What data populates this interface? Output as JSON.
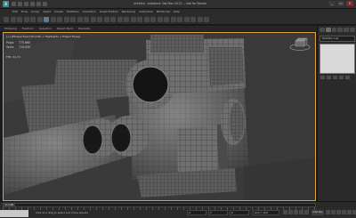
{
  "app": {
    "logo": "3",
    "title": "Untitled - Autodesk 3ds Max 2013 — Not for Resale"
  },
  "window_controls": [
    "_",
    "▭",
    "✕"
  ],
  "menus": [
    "Edit",
    "Tools",
    "Group",
    "Views",
    "Create",
    "Modifiers",
    "Animation",
    "Graph Editors",
    "Rendering",
    "Customize",
    "MAXScript",
    "Help"
  ],
  "ribbon_tabs": [
    "Modeling",
    "Freeform",
    "Selection",
    "Object Paint",
    "Populate"
  ],
  "viewport": {
    "label": "[+] [Perspective] [Smooth + Highlights + Edged Faces]",
    "stats": [
      {
        "key": "Polys:",
        "value": "773,660"
      },
      {
        "key": "Verts:",
        "value": "719,920"
      }
    ],
    "fps_label": "FPS:",
    "fps_value": "24.31"
  },
  "command_panel": {
    "modifier_list": "Modifier List"
  },
  "time_slider": {
    "frame": "0 / 100"
  },
  "status": {
    "text": "Click and drag to select and move objects",
    "x_label": "X:",
    "y_label": "Y:",
    "z_label": "Z:",
    "grid": "Grid = 10.0",
    "autokey": "Auto Key"
  },
  "colors": {
    "viewport_bg": "#3a3a3a",
    "active_border": "#e0a23a",
    "ui_dark": "#2b2b2b"
  }
}
